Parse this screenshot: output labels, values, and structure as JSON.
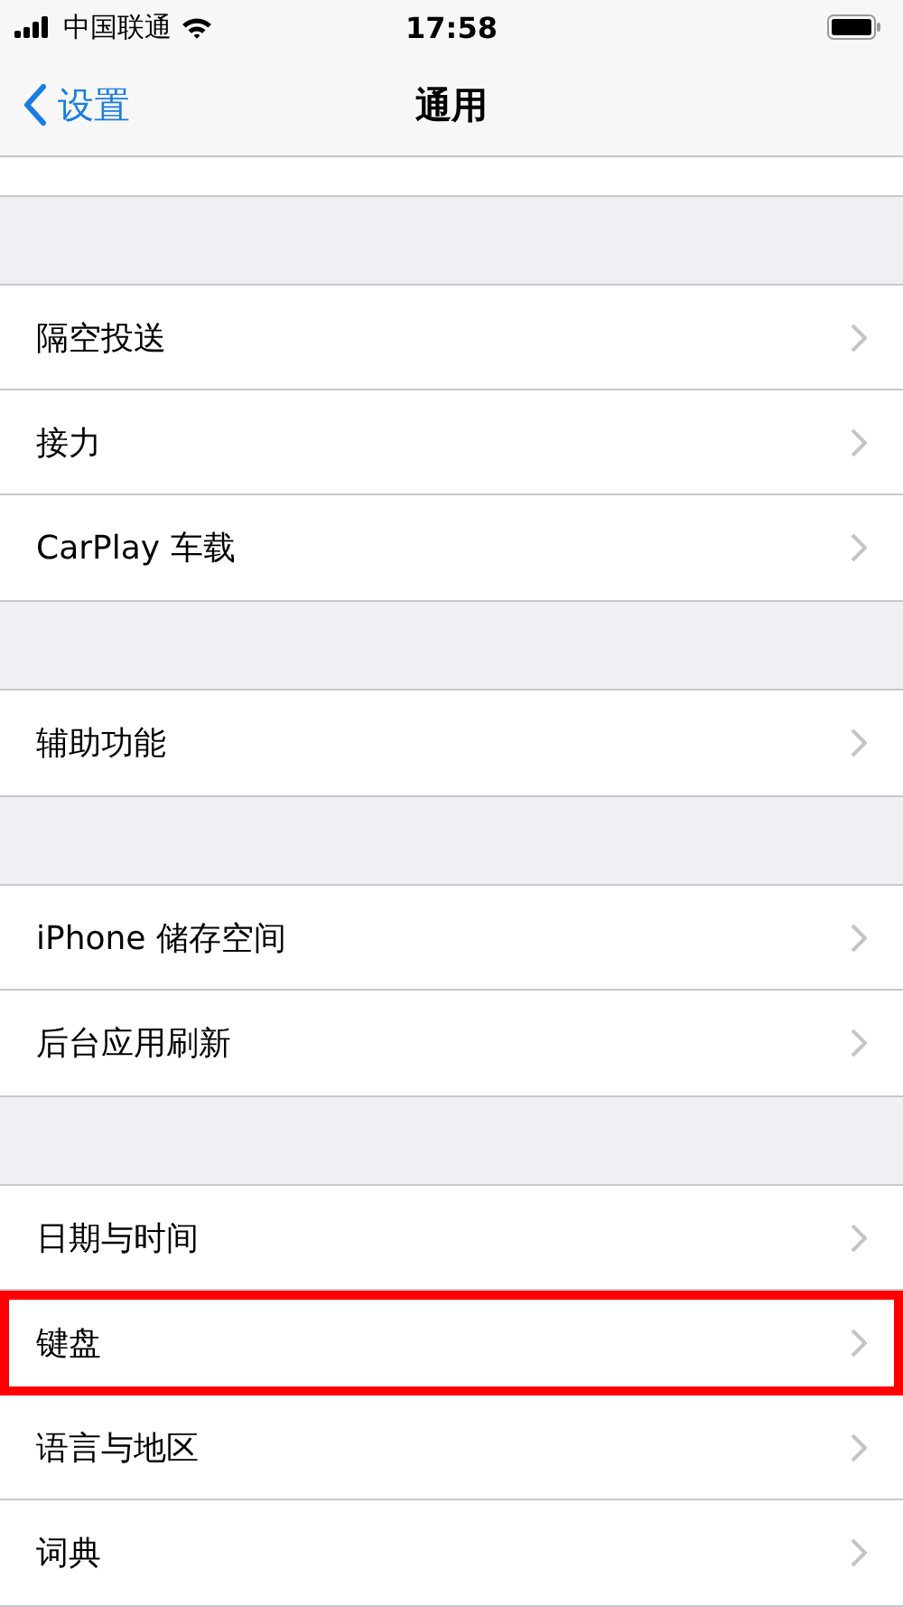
{
  "status_bar": {
    "carrier": "中国联通",
    "time": "17:58"
  },
  "nav": {
    "back": "设置",
    "title": "通用"
  },
  "groups": [
    {
      "items": [
        {
          "label": "隔空投送",
          "highlighted": false
        },
        {
          "label": "接力",
          "highlighted": false
        },
        {
          "label": "CarPlay 车载",
          "highlighted": false
        }
      ]
    },
    {
      "items": [
        {
          "label": "辅助功能",
          "highlighted": false
        }
      ]
    },
    {
      "items": [
        {
          "label": "iPhone 储存空间",
          "highlighted": false
        },
        {
          "label": "后台应用刷新",
          "highlighted": false
        }
      ]
    },
    {
      "items": [
        {
          "label": "日期与时间",
          "highlighted": false
        },
        {
          "label": "键盘",
          "highlighted": true
        },
        {
          "label": "语言与地区",
          "highlighted": false
        },
        {
          "label": "词典",
          "highlighted": false
        }
      ]
    }
  ]
}
